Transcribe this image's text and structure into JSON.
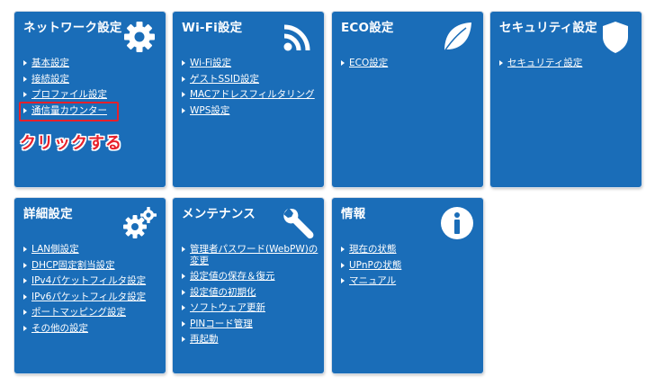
{
  "tiles": {
    "network": {
      "title": "ネットワーク設定",
      "icon": "gear-icon",
      "links": [
        "基本設定",
        "接続設定",
        "プロファイル設定",
        "通信量カウンター"
      ],
      "annotation": "クリックする",
      "annotation_color": "#e8202a"
    },
    "wifi": {
      "title": "Wi-Fi設定",
      "icon": "wifi-icon",
      "links": [
        "Wi-Fi設定",
        "ゲストSSID設定",
        "MACアドレスフィルタリング",
        "WPS設定"
      ]
    },
    "eco": {
      "title": "ECO設定",
      "icon": "leaf-icon",
      "links": [
        "ECO設定"
      ]
    },
    "security": {
      "title": "セキュリティ設定",
      "icon": "shield-icon",
      "links": [
        "セキュリティ設定"
      ]
    },
    "advanced": {
      "title": "詳細設定",
      "icon": "gears-icon",
      "links": [
        "LAN側設定",
        "DHCP固定割当設定",
        "IPv4パケットフィルタ設定",
        "IPv6パケットフィルタ設定",
        "ポートマッピング設定",
        "その他の設定"
      ]
    },
    "maintenance": {
      "title": "メンテナンス",
      "icon": "wrench-icon",
      "links": [
        "管理者パスワード(WebPW)の変更",
        "設定値の保存＆復元",
        "設定値の初期化",
        "ソフトウェア更新",
        "PINコード管理",
        "再起動"
      ]
    },
    "info": {
      "title": "情報",
      "icon": "info-icon",
      "links": [
        "現在の状態",
        "UPnPの状態",
        "マニュアル"
      ]
    }
  },
  "colors": {
    "tile_bg": "#1a6db8",
    "highlight": "#e8202a"
  }
}
